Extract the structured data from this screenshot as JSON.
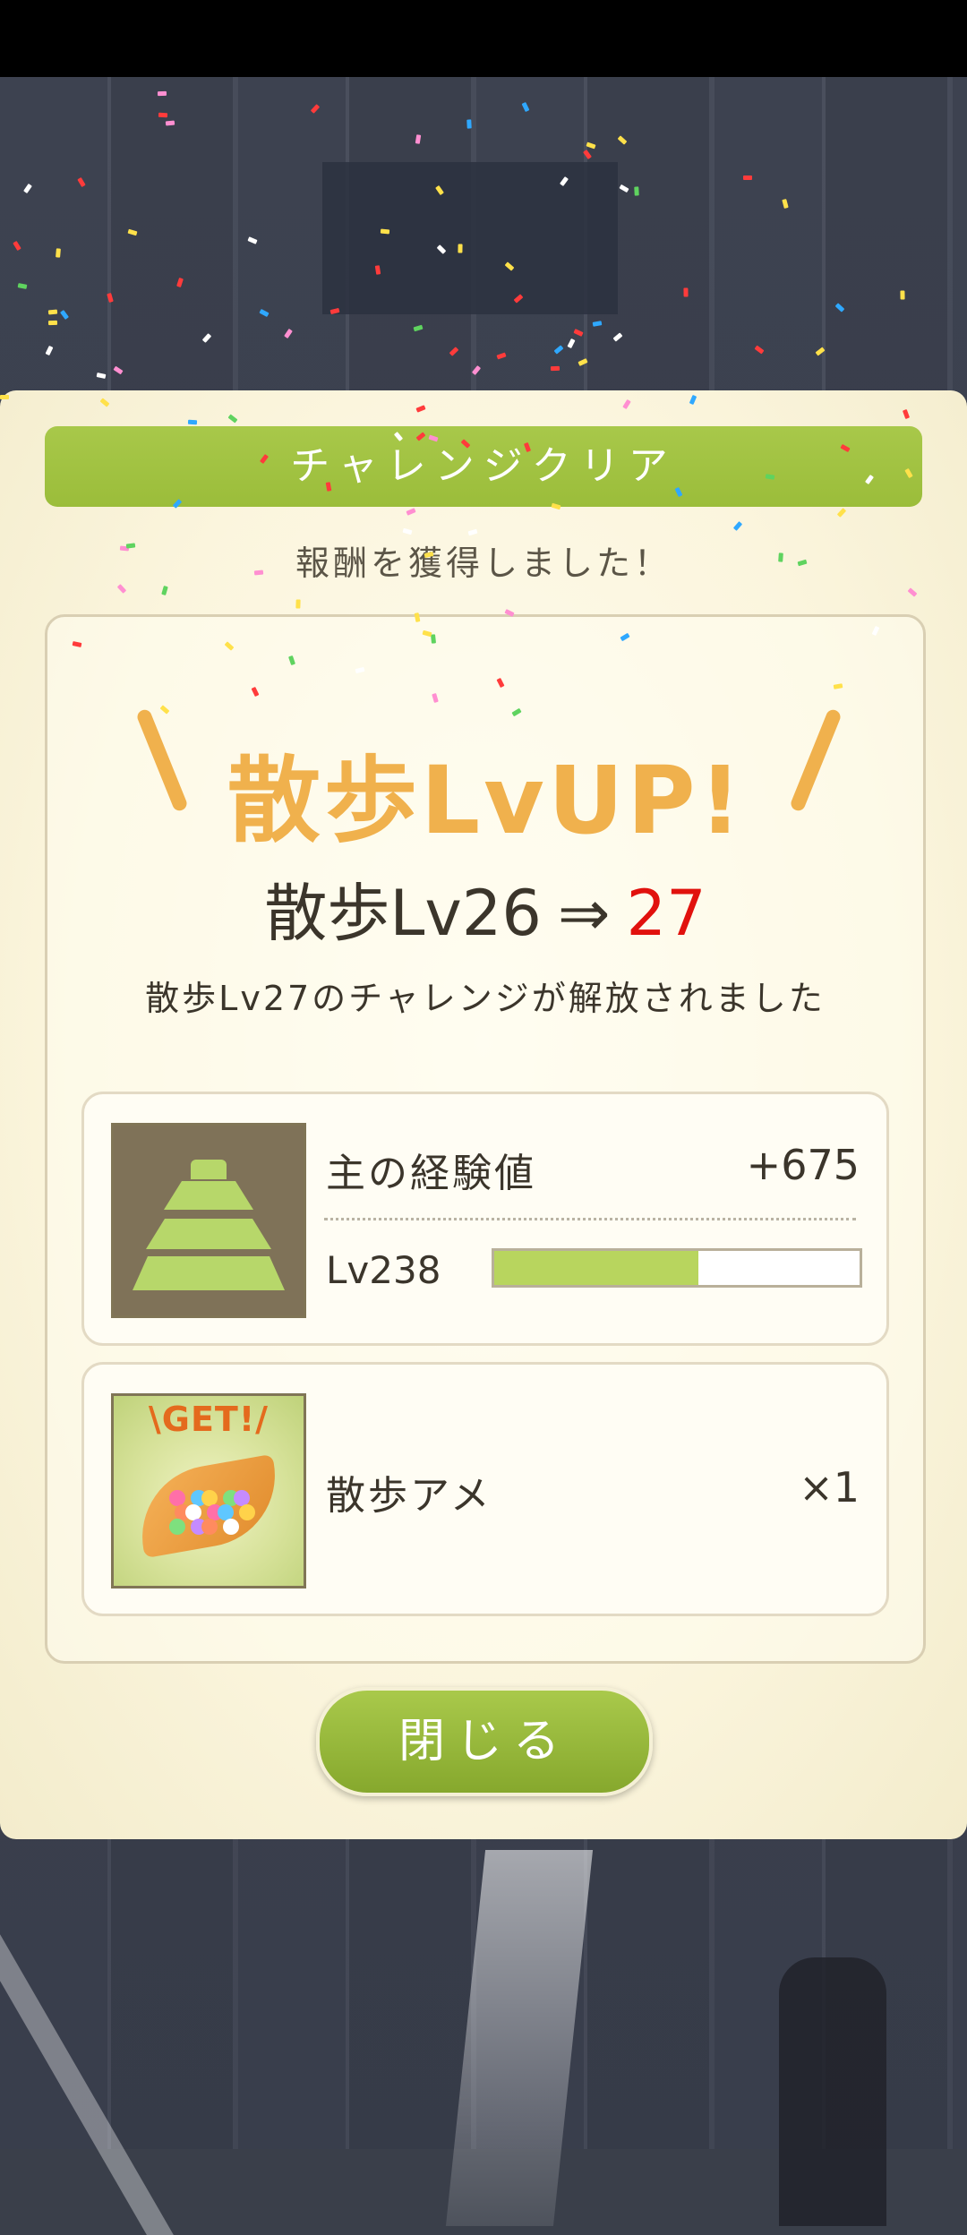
{
  "dialog": {
    "banner_title": "チャレンジクリア",
    "subtitle": "報酬を獲得しました！",
    "levelup_title": "散歩LvUP!",
    "level_from": "散歩Lv26",
    "arrow": "⇒",
    "level_to": "27",
    "unlock_message": "散歩Lv27のチャレンジが解放されました",
    "close_label": "閉じる"
  },
  "rewards": [
    {
      "name": "主の経験値",
      "amount": "+675",
      "icon": "castle-icon",
      "level_label": "Lv238",
      "progress_fraction": 0.56
    },
    {
      "name": "散歩アメ",
      "amount": "×1",
      "icon": "candy-icon",
      "badge": "\\GET!/"
    }
  ],
  "colors": {
    "accent_green": "#9bbd3a",
    "levelup_orange": "#f0b14d",
    "new_level_red": "#e1110d",
    "text_dark": "#3b352b"
  }
}
